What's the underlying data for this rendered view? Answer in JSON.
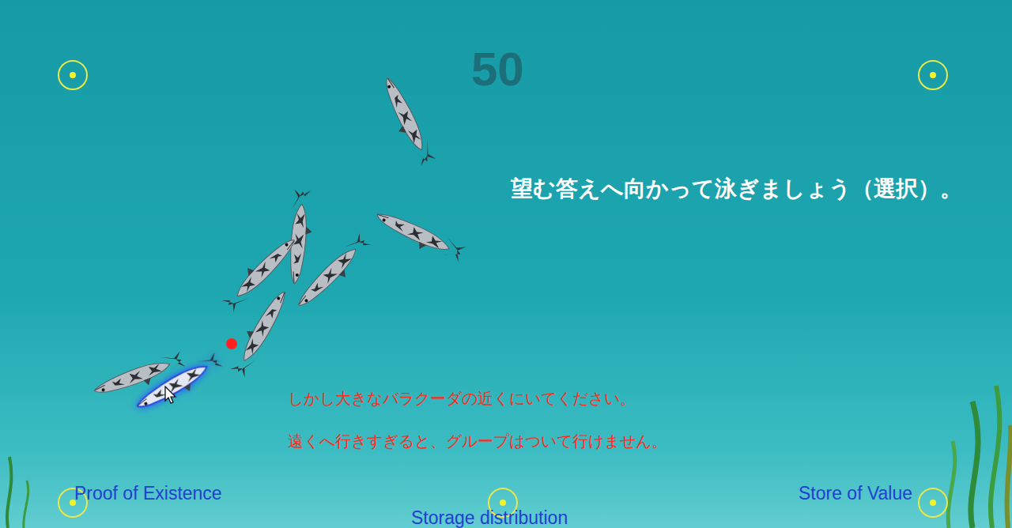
{
  "timer": "50",
  "prompt": "望む答えへ向かって泳ぎましょう（選択）。",
  "warnings": [
    "しかし大きなバラクーダの近くにいてください。",
    "遠くへ行きすぎると、グループはついて行けません。"
  ],
  "answers": [
    {
      "label": "Proof of Existence",
      "selected": false
    },
    {
      "label": "Storage distribution",
      "selected": false
    },
    {
      "label": "Store of Value",
      "selected": false
    }
  ]
}
